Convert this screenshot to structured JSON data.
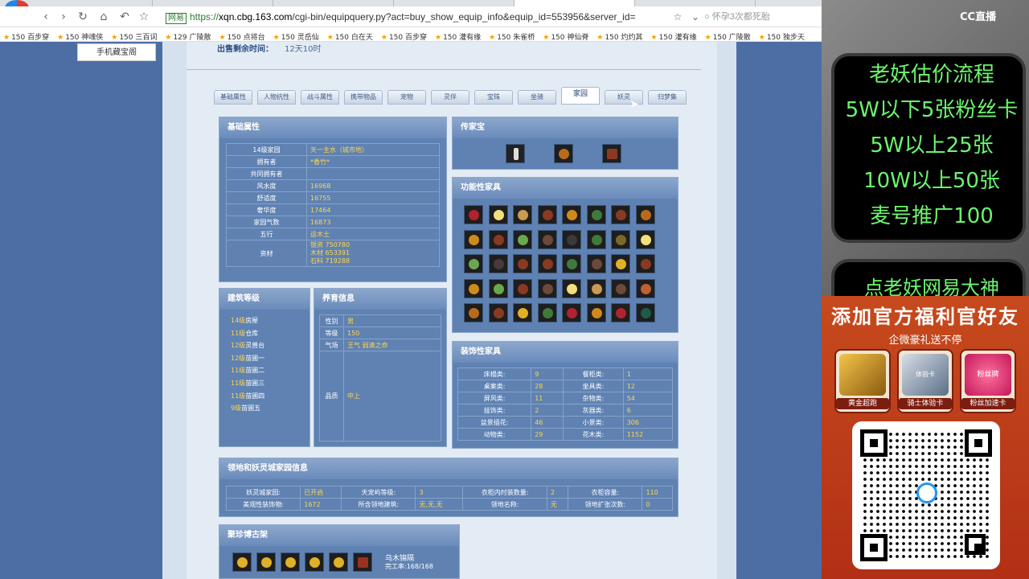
{
  "browser": {
    "address_label": "网易",
    "address_host_prefix": "https://",
    "address_host": "xqn.cbg.163.com",
    "address_path": "/cgi-bin/equipquery.py?act=buy_show_equip_info&equip_id=553956&server_id=",
    "search_text": "怀孕3次都死胎",
    "bookmarks": [
      "150 百步穿",
      "150 神魂侠",
      "150 三百词",
      "129 广陵散",
      "150 点将台",
      "150 灵岳仙",
      "150 白在天",
      "150 百步穿",
      "150 灌有缘",
      "150 朱雀桥",
      "150 神仙脊",
      "150 灼灼其",
      "150 灌有缘",
      "150 广陵散",
      "150 独步天"
    ]
  },
  "side": {
    "mobile_button": "手机藏宝阁"
  },
  "sale": {
    "label": "出售剩余时间：",
    "value": "12天10时"
  },
  "tabs": [
    "基础属性",
    "人物抗性",
    "战斗属性",
    "携带物品",
    "宠物",
    "灵伴",
    "宝珠",
    "坐骑",
    "家园",
    "妖灵",
    "归梦集"
  ],
  "basic": {
    "title": "基础属性",
    "rows": [
      {
        "k": "14级家园",
        "v": "天一主水（城市地）"
      },
      {
        "k": "拥有者",
        "v": "*香竹*"
      },
      {
        "k": "共同拥有者",
        "v": ""
      },
      {
        "k": "风水度",
        "v": "16968"
      },
      {
        "k": "舒适度",
        "v": "16755"
      },
      {
        "k": "奢华度",
        "v": "17464"
      },
      {
        "k": "家园气数",
        "v": "16873"
      },
      {
        "k": "五行",
        "v": "运木土"
      }
    ],
    "resource_label": "资材",
    "resources": [
      "银资 750780",
      "木材 653391",
      "石料 719288"
    ]
  },
  "heirloom": {
    "title": "传家宝"
  },
  "functional": {
    "title": "功能性家具"
  },
  "building": {
    "title": "建筑等级",
    "items": [
      {
        "n": "14级",
        "name": "房屋"
      },
      {
        "n": "11级",
        "name": "仓库"
      },
      {
        "n": "12级",
        "name": "灵兽台"
      },
      {
        "n": "12级",
        "name": "苗圃一"
      },
      {
        "n": "11级",
        "name": "苗圃二"
      },
      {
        "n": "11级",
        "name": "苗圃三"
      },
      {
        "n": "11级",
        "name": "苗圃四"
      },
      {
        "n": "9级",
        "name": "苗圃五"
      }
    ]
  },
  "breed": {
    "title": "养育信息",
    "rows": [
      {
        "k": "性别",
        "v": "男"
      },
      {
        "k": "等级",
        "v": "150"
      },
      {
        "k": "气场",
        "v": "王气 弱清之命"
      }
    ],
    "quality_label": "品质",
    "quality_value": "中上"
  },
  "decor": {
    "title": "装饰性家具",
    "rows": [
      [
        "床榻类:",
        "9",
        "餐柜类:",
        "1"
      ],
      [
        "桌案类:",
        "28",
        "坐具类:",
        "12"
      ],
      [
        "屏风类:",
        "11",
        "杂物类:",
        "54"
      ],
      [
        "挂饰类:",
        "2",
        "灰器类:",
        "6"
      ],
      [
        "盆景插花:",
        "46",
        "小景类:",
        "306"
      ],
      [
        "动物类:",
        "29",
        "花木类:",
        "1152"
      ]
    ]
  },
  "territory": {
    "title": "领地和妖灵城家园信息",
    "rows": [
      [
        "妖灵城家园:",
        "已开启",
        "天宠屿等级:",
        "3",
        "衣柜内时装数量:",
        "2",
        "衣柜容量:",
        "110"
      ],
      [
        "美观性装饰物:",
        "1672",
        "所含领地建筑:",
        "无,无,无",
        "领地名称:",
        "无",
        "领地扩张次数:",
        "0"
      ]
    ]
  },
  "antique": {
    "title": "聚珍博古架",
    "item_name": "乌木锦隔",
    "item_progress": "完工率:168/168"
  },
  "stream": {
    "logo": "CC直播",
    "board_lines": [
      "老妖估价流程",
      "5W以下5张粉丝卡",
      "5W以上25张",
      "10W以上50张",
      "麦号推广100"
    ],
    "board2_line": "点老妖网易大神",
    "promo_title": "添加官方福利官好友",
    "promo_sub": "企微豪礼送不停",
    "gifts": [
      "黄金超跑",
      "骑士体验卡",
      "粉丝加速卡"
    ],
    "gift_badges": [
      "",
      "体验卡",
      "粉丝牌"
    ]
  },
  "colors": {
    "page_bg": "#4c6ea4",
    "panel": "#5f82b3",
    "value_yellow": "#ffd54f",
    "green_text": "#6cf56c",
    "promo_red": "#c64a1d"
  }
}
